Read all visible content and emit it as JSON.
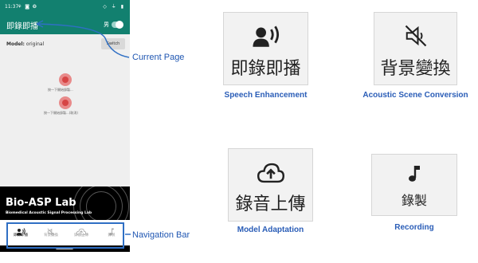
{
  "phone": {
    "status_bar": {
      "time": "11:37",
      "left_icons": "⚘ ◙ ❂",
      "right_icons": "◇ ⏚ ▮"
    },
    "app_bar": {
      "title": "即錄即播",
      "toggle_label": "男",
      "toggle_on": true
    },
    "content": {
      "model_label": "Model:",
      "model_value": "original",
      "switch_button": "Switch",
      "record_hint_1": "按一下開始錄製...",
      "record_hint_2": "按一下開始錄製...(取消)"
    },
    "banner": {
      "title": "Bio-ASP Lab",
      "subtitle": "Biomedical Acoustic Signal Processing Lab"
    },
    "nav": [
      {
        "label": "即錄即播",
        "icon": "speaker-waves-icon",
        "active": true
      },
      {
        "label": "背景變換",
        "icon": "speaker-muted-icon",
        "active": false
      },
      {
        "label": "錄音上傳",
        "icon": "cloud-upload-icon",
        "active": false
      },
      {
        "label": "錄製",
        "icon": "music-note-icon",
        "active": false
      }
    ]
  },
  "annotations": {
    "current_page": "Current Page",
    "navigation_bar": "Navigation Bar"
  },
  "cards": [
    {
      "text": "即錄即播",
      "caption": "Speech Enhancement",
      "icon": "speaker-waves-icon"
    },
    {
      "text": "背景變換",
      "caption": "Acoustic Scene Conversion",
      "icon": "speaker-muted-icon"
    },
    {
      "text": "錄音上傳",
      "caption": "Model Adaptation",
      "icon": "cloud-upload-icon"
    },
    {
      "text": "錄製",
      "caption": "Recording",
      "icon": "music-note-icon"
    }
  ],
  "colors": {
    "app_bar": "#12806f",
    "annotation_blue": "#2f6fc4",
    "record_button": "#d64545"
  }
}
